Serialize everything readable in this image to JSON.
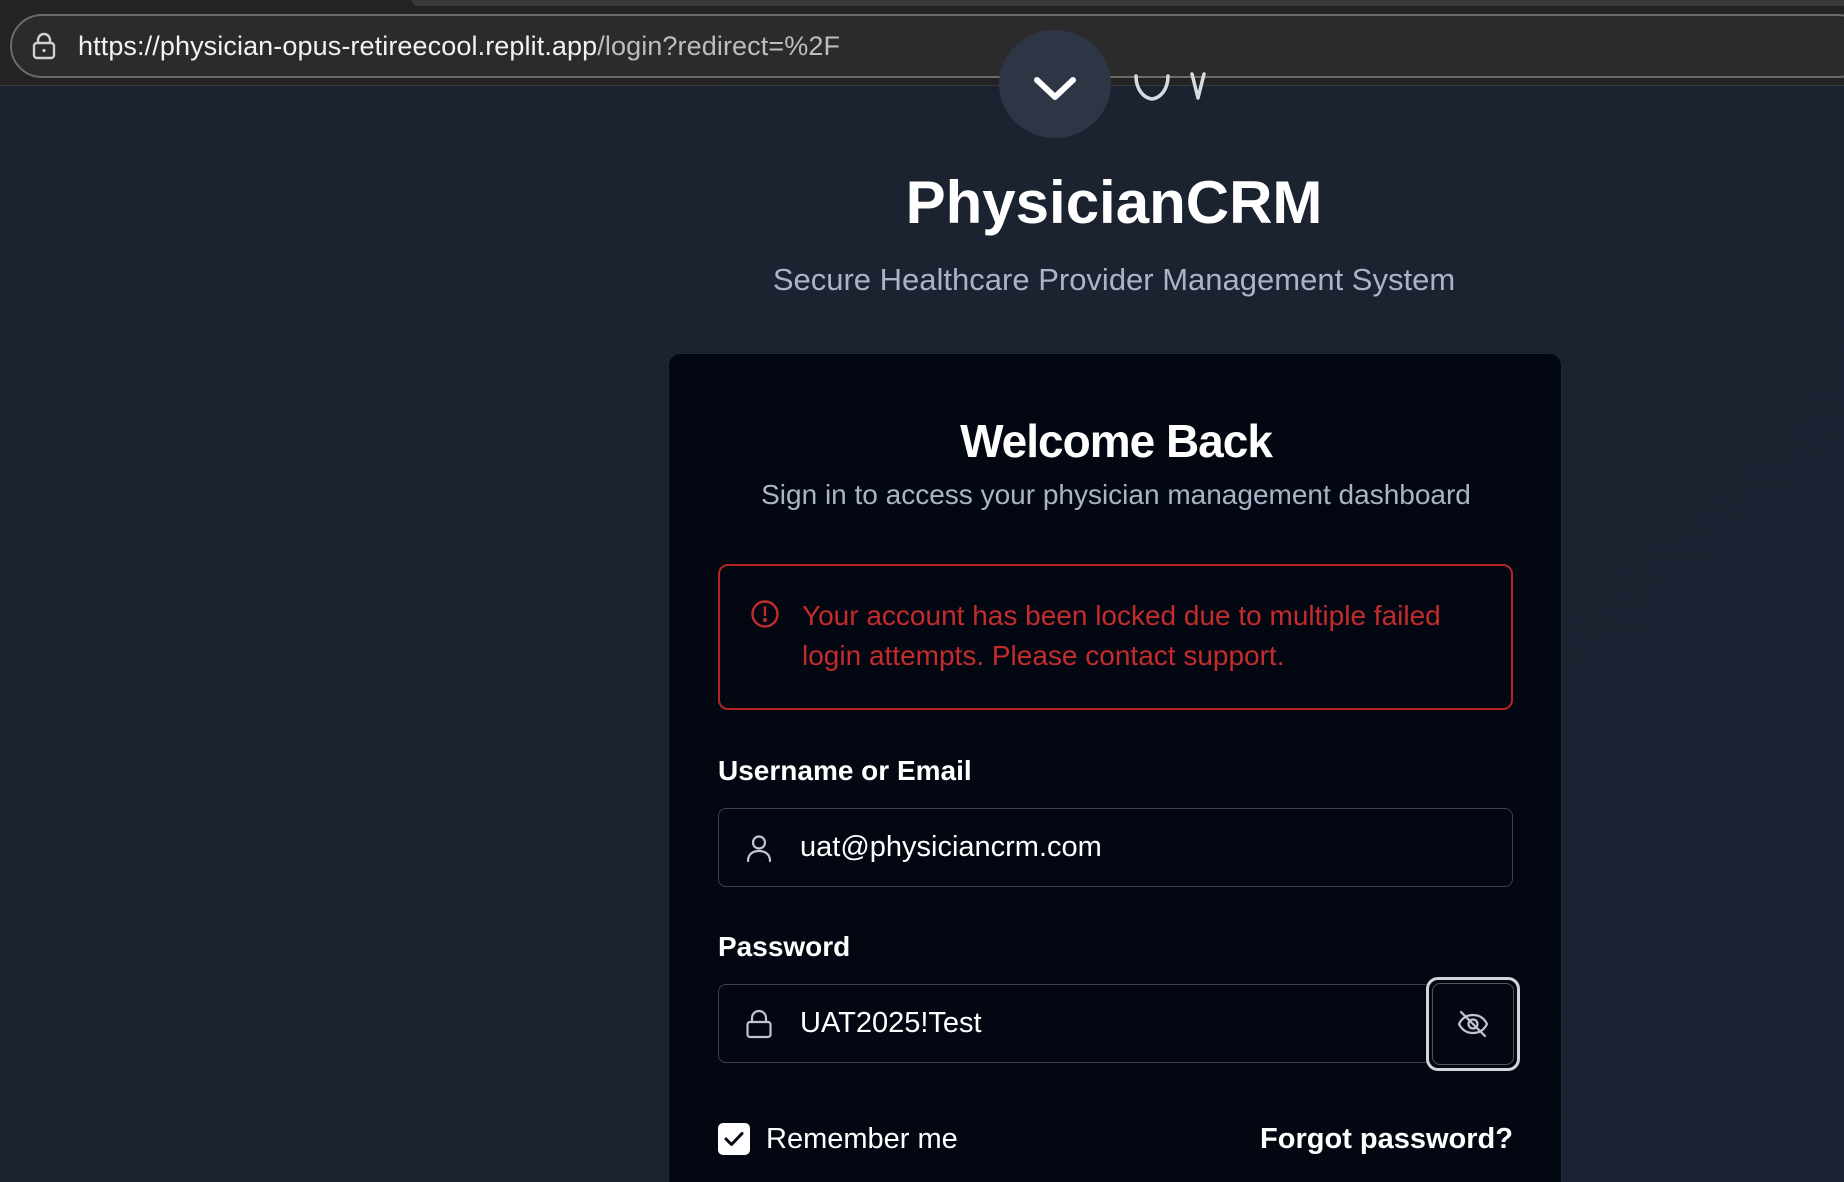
{
  "browser": {
    "url_host": "https://physician-opus-retireecool.replit.app",
    "url_path": "/login?redirect=%2F"
  },
  "header": {
    "title": "PhysicianCRM",
    "subtitle": "Secure Healthcare Provider Management System"
  },
  "card": {
    "title": "Welcome Back",
    "subtitle": "Sign in to access your physician management dashboard",
    "alert": "Your account has been locked due to multiple failed login attempts. Please contact support.",
    "username_label": "Username or Email",
    "username_value": "uat@physiciancrm.com",
    "password_label": "Password",
    "password_value": "UAT2025!Test",
    "remember_label": "Remember me",
    "forgot_label": "Forgot password?"
  },
  "colors": {
    "background": "#1b2230",
    "card": "#030712",
    "error": "#c42c2c",
    "muted_text": "#a9b4c6"
  }
}
